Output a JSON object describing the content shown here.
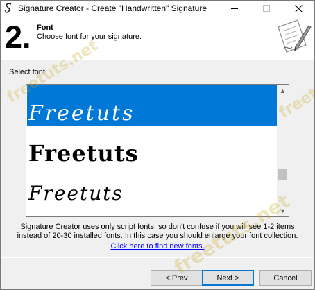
{
  "window": {
    "title": "Signature Creator - Create \"Handwritten\" Signature",
    "app_icon": "script-s-icon",
    "controls": [
      "minimize-icon",
      "maximize-icon",
      "close-icon"
    ]
  },
  "header": {
    "step_number": "2.",
    "step_title": "Font",
    "step_subtitle": "Choose font for your signature.",
    "illustration": "pen-signature-icon"
  },
  "select_label": "Select font:",
  "font_list": {
    "items": [
      {
        "sample": "Freetuts",
        "selected": true
      },
      {
        "sample": "Freetuts",
        "selected": false
      },
      {
        "sample": "Freetuts",
        "selected": false
      }
    ],
    "scroll_position": 0.62
  },
  "info": {
    "line1": "Signature Creator uses only script fonts, so don't confuse if you will see 1-2 items",
    "line2": "instead of 20-30 installed fonts. In this case you should enlarge your font collection.",
    "link": "Click here to find new fonts."
  },
  "buttons": {
    "prev": "< Prev",
    "next": "Next >",
    "cancel": "Cancel"
  },
  "watermark": "freetuts.net",
  "colors": {
    "selection": "#0078d7",
    "link": "#0000ff",
    "window_bg": "#f0f0f0"
  }
}
